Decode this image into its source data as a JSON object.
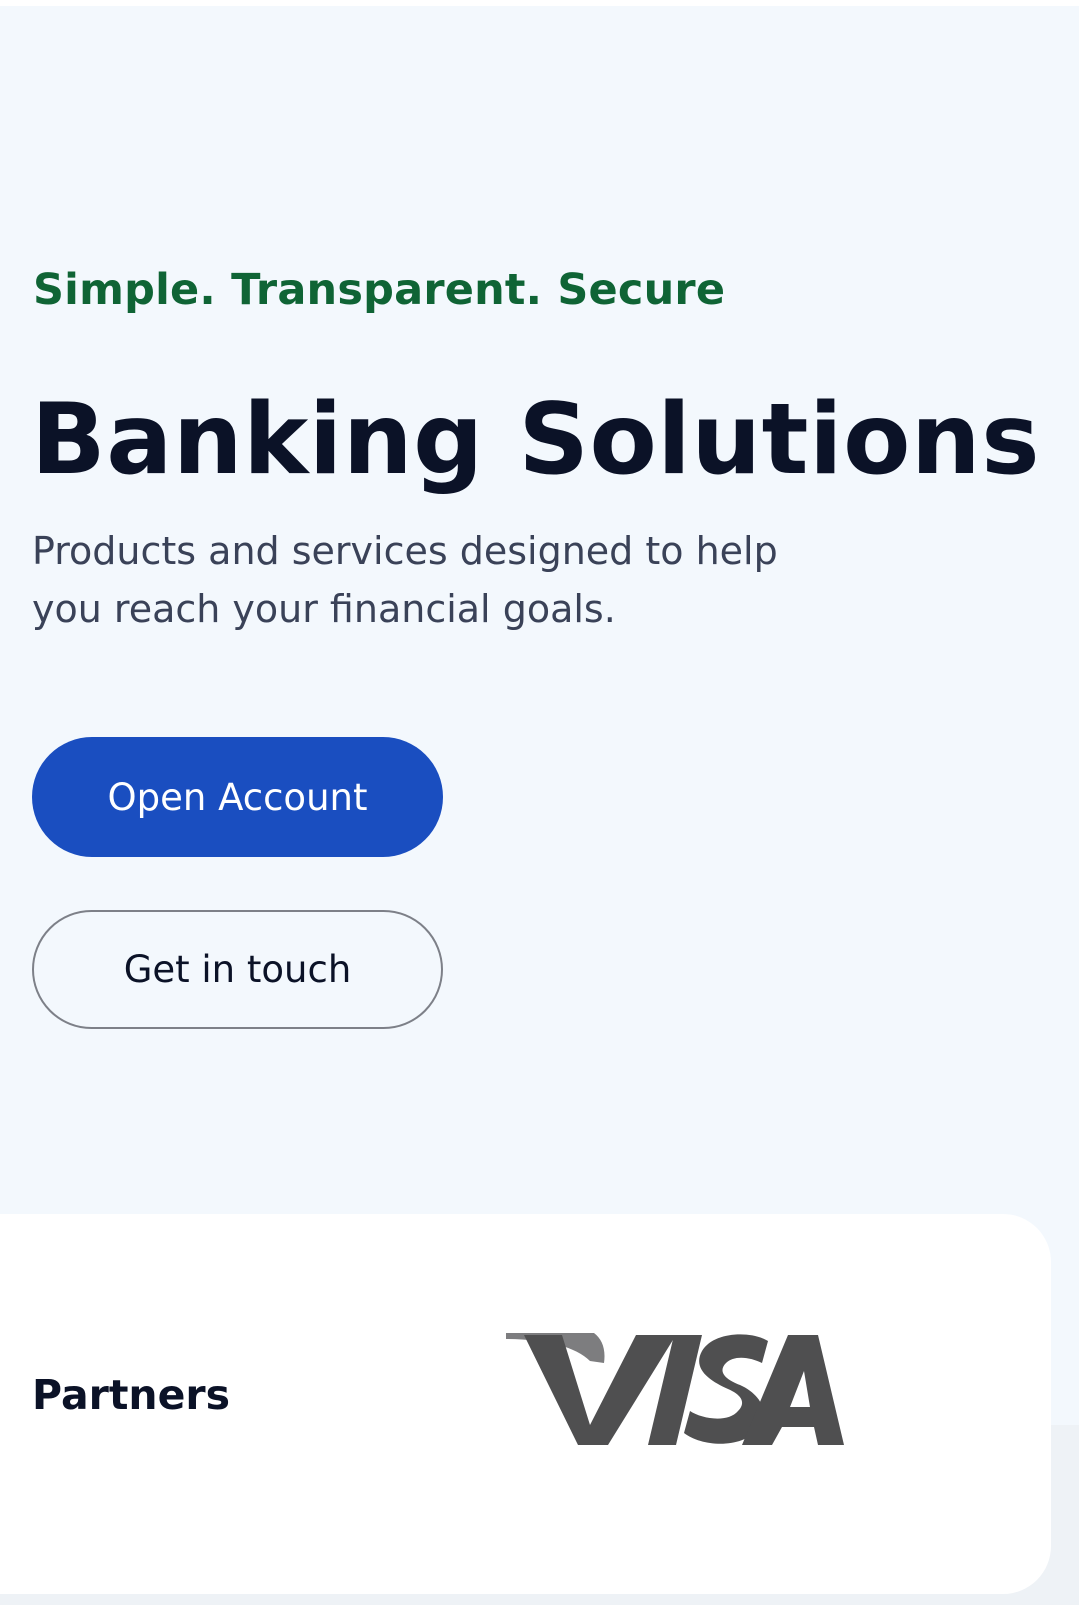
{
  "hero": {
    "eyebrow": "Simple. Transparent. Secure",
    "headline": "Banking Solutions",
    "subtext": "Products and services designed to help you reach your financial goals.",
    "primary_button": "Open Account",
    "secondary_button": "Get in touch"
  },
  "partners": {
    "label": "Partners",
    "logos": [
      {
        "name": "VISA",
        "icon": "visa-logo"
      }
    ]
  },
  "colors": {
    "accent_green": "#0f6435",
    "primary_blue": "#1a4ec0",
    "heading": "#0b1227",
    "body_text": "#3a4258",
    "hero_bg": "#f3f8fd",
    "visa_gray": "#4f4f50"
  }
}
